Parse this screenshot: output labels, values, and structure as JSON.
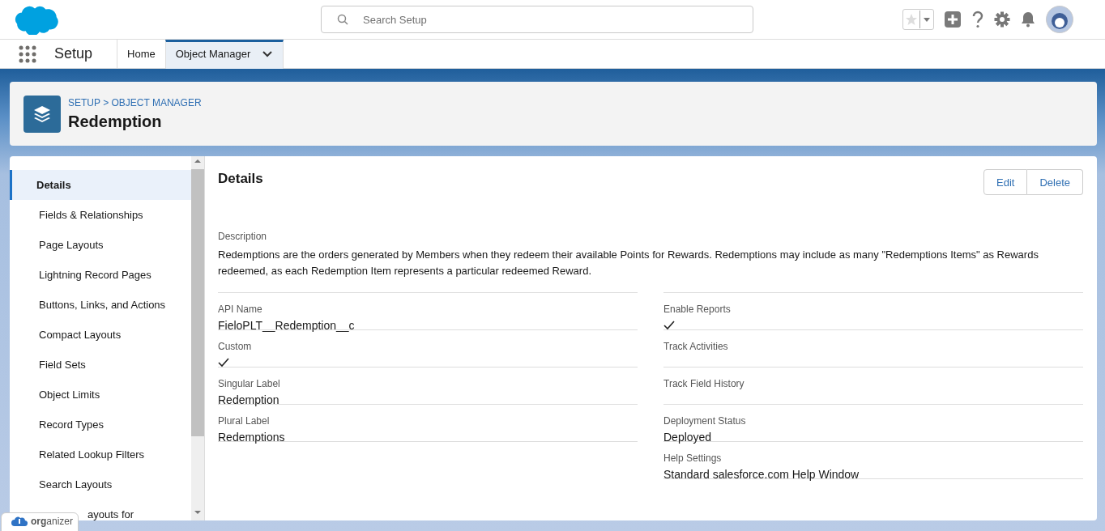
{
  "header": {
    "search": {
      "placeholder": "Search Setup"
    }
  },
  "nav": {
    "app_name": "Setup",
    "tabs": [
      {
        "label": "Home",
        "selected": false
      },
      {
        "label": "Object Manager",
        "selected": true
      }
    ]
  },
  "page_header": {
    "breadcrumb": "SETUP > OBJECT MANAGER",
    "title": "Redemption"
  },
  "sidebar": {
    "items": [
      {
        "label": "Details",
        "selected": true
      },
      {
        "label": "Fields & Relationships",
        "selected": false
      },
      {
        "label": "Page Layouts",
        "selected": false
      },
      {
        "label": "Lightning Record Pages",
        "selected": false
      },
      {
        "label": "Buttons, Links, and Actions",
        "selected": false
      },
      {
        "label": "Compact Layouts",
        "selected": false
      },
      {
        "label": "Field Sets",
        "selected": false
      },
      {
        "label": "Object Limits",
        "selected": false
      },
      {
        "label": "Record Types",
        "selected": false
      },
      {
        "label": "Related Lookup Filters",
        "selected": false
      },
      {
        "label": "Search Layouts",
        "selected": false
      },
      {
        "label": "ayouts for",
        "selected": false
      }
    ]
  },
  "details": {
    "title": "Details",
    "buttons": [
      "Edit",
      "Delete"
    ],
    "description_label": "Description",
    "description": "Redemptions are the orders generated by Members when they redeem their available Points for Rewards. Redemptions may include as many \"Redemptions Items\" as Rewards redeemed, as each Redemption Item represents a particular redeemed Reward.",
    "left_fields": [
      {
        "kind": "text",
        "label": "API Name",
        "value": "FieloPLT__Redemption__c"
      },
      {
        "kind": "check",
        "label": "Custom",
        "checked": true
      },
      {
        "kind": "text",
        "label": "Singular Label",
        "value": "Redemption"
      },
      {
        "kind": "text",
        "label": "Plural Label",
        "value": "Redemptions"
      }
    ],
    "right_fields": [
      {
        "kind": "check",
        "label": "Enable Reports",
        "checked": true
      },
      {
        "kind": "check",
        "label": "Track Activities",
        "checked": false
      },
      {
        "kind": "check",
        "label": "Track Field History",
        "checked": false
      },
      {
        "kind": "text",
        "label": "Deployment Status",
        "value": "Deployed"
      },
      {
        "kind": "text",
        "label": "Help Settings",
        "value": "Standard salesforce.com Help Window"
      }
    ]
  },
  "organizer": {
    "label": "**org**anizer"
  }
}
